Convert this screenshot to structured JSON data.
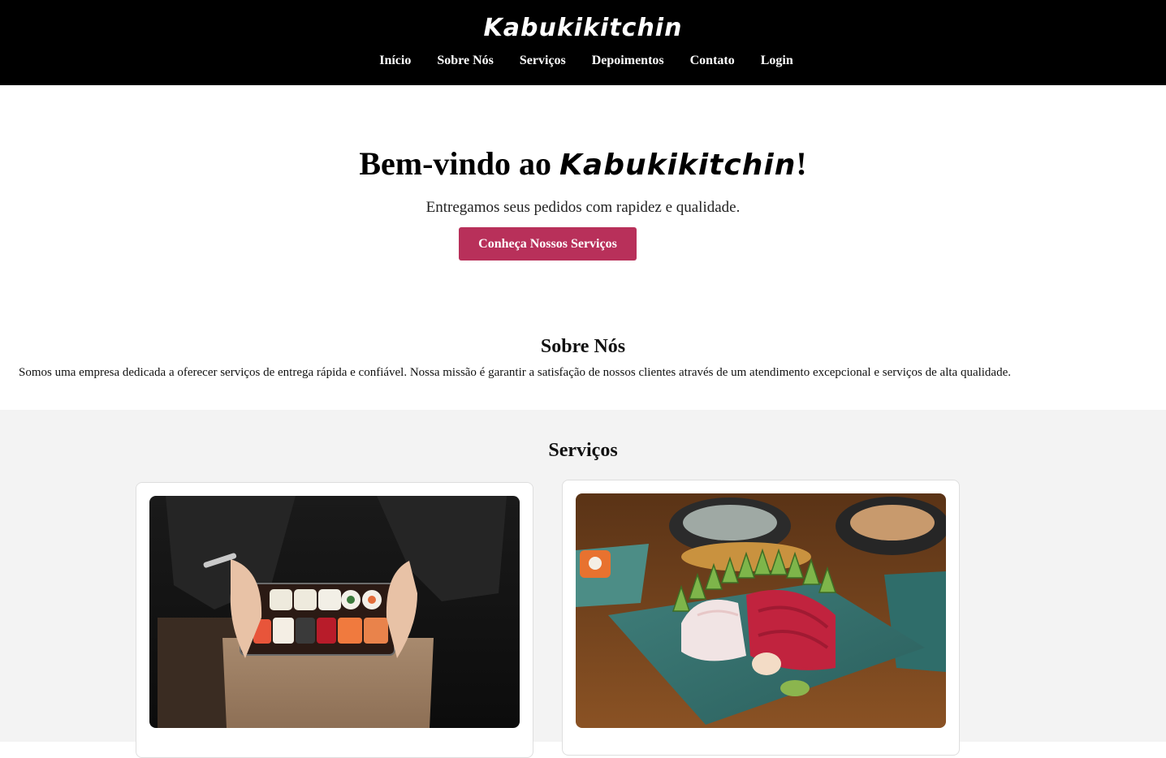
{
  "header": {
    "brand": "Kabukikitchin",
    "nav": [
      "Início",
      "Sobre Nós",
      "Serviços",
      "Depoimentos",
      "Contato",
      "Login"
    ]
  },
  "hero": {
    "title_prefix": "Bem-vindo ao ",
    "title_brand": "Kabukikitchin",
    "title_suffix": "!",
    "subtitle": "Entregamos seus pedidos com rapidez e qualidade.",
    "button": "Conheça Nossos Serviços"
  },
  "about": {
    "title": "Sobre Nós",
    "text": "Somos uma empresa dedicada a oferecer serviços de entrega rápida e confiável. Nossa missão é garantir a satisfação de nossos clientes através de um atendimento excepcional e serviços de alta qualidade."
  },
  "services": {
    "title": "Serviços"
  },
  "colors": {
    "header_bg": "#000000",
    "accent": "#b8305a",
    "section_bg": "#f3f3f3"
  }
}
